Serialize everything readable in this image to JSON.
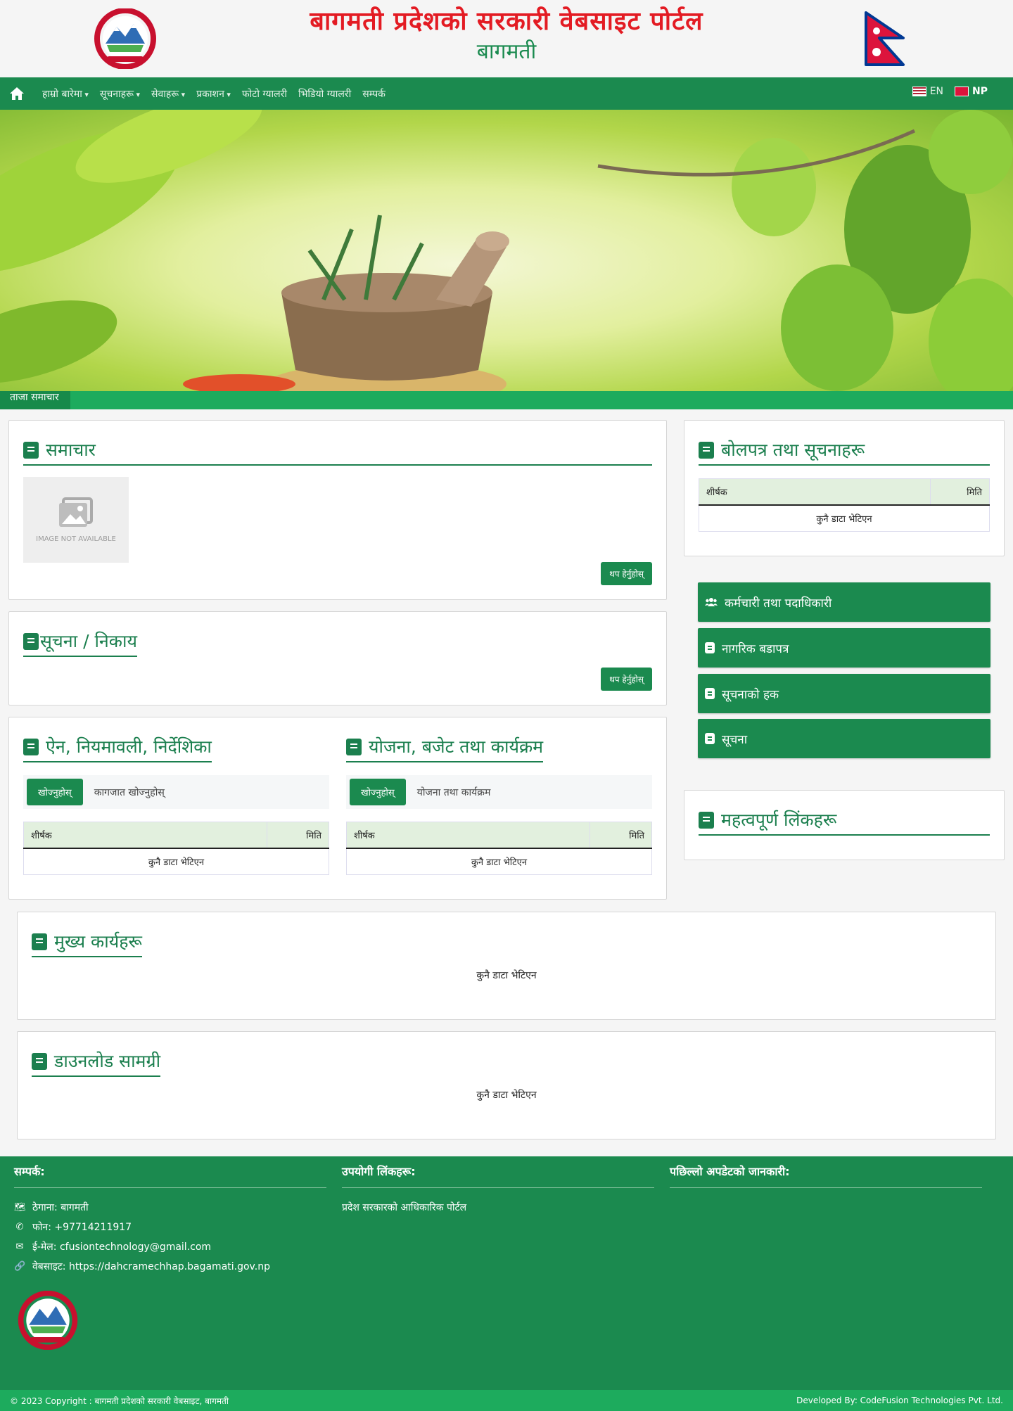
{
  "header": {
    "title": "बागमती प्रदेशको सरकारी वेबसाइट पोर्टल",
    "subtitle": "बागमती"
  },
  "nav": {
    "items": [
      {
        "label": "हाम्रो बारेमा",
        "dropdown": true
      },
      {
        "label": "सूचनाहरू",
        "dropdown": true
      },
      {
        "label": "सेवाहरू",
        "dropdown": true
      },
      {
        "label": "प्रकाशन",
        "dropdown": true
      },
      {
        "label": "फोटो ग्यालरी",
        "dropdown": false
      },
      {
        "label": "भिडियो ग्यालरी",
        "dropdown": false
      },
      {
        "label": "सम्पर्क",
        "dropdown": false
      }
    ],
    "lang_en": "EN",
    "lang_np": "NP"
  },
  "ticker": {
    "label": "ताजा समाचार"
  },
  "news": {
    "title": "समाचार",
    "image_text": "IMAGE NOT AVAILABLE",
    "more": "थप हेर्नुहोस्"
  },
  "notice": {
    "title": "सूचना / निकाय",
    "more": "थप हेर्नुहोस्"
  },
  "left_table": {
    "title": "ऐन, नियमावली, निर्देशिका",
    "button": "खोज्नुहोस्",
    "search_placeholder": "कागजात खोज्नुहोस्",
    "col1": "शीर्षक",
    "col2": "मिति",
    "empty": "कुनै डाटा भेटिएन"
  },
  "right_table": {
    "title": "योजना, बजेट तथा कार्यक्रम",
    "button": "खोज्नुहोस्",
    "search_placeholder": "योजना तथा कार्यक्रम",
    "col1": "शीर्षक",
    "col2": "मिति",
    "empty": "कुनै डाटा भेटिएन"
  },
  "side_table": {
    "title": "बोलपत्र तथा सूचनाहरू",
    "col1": "शीर्षक",
    "col2": "मिति",
    "empty": "कुनै डाटा भेटिएन"
  },
  "side_buttons": [
    {
      "label": "कर्मचारी तथा पदाधिकारी",
      "icon": "users-icon"
    },
    {
      "label": "नागरिक बडापत्र",
      "icon": "book-icon"
    },
    {
      "label": "सूचनाको हक",
      "icon": "book-icon"
    },
    {
      "label": "सूचना",
      "icon": "book-icon"
    }
  ],
  "side_section": {
    "title": "महत्वपूर्ण लिंकहरू"
  },
  "section_a": {
    "title": "मुख्य कार्यहरू",
    "empty": "कुनै डाटा भेटिएन"
  },
  "section_b": {
    "title": "डाउनलोड सामग्री",
    "empty": "कुनै डाटा भेटिएन"
  },
  "footer": {
    "col1_title": "सम्पर्क:",
    "address": "ठेगाना: बागमती",
    "phone": "फोन: +97714211917",
    "email": "ई-मेल: cfusiontechnology@gmail.com",
    "website": "वेबसाइट: https://dahcramechhap.bagamati.gov.np",
    "col2_title": "उपयोगी लिंकहरू:",
    "col2_item": "प्रदेश सरकारको आधिकारिक पोर्टल",
    "col3_title": "पछिल्लो अपडेटको जानकारी:"
  },
  "copyright": {
    "left": "© 2023 Copyright : बागमती प्रदेशको सरकारी वेबसाइट, बागमती",
    "right": "Developed By: CodeFusion Technologies Pvt. Ltd."
  },
  "colors": {
    "primary": "#1b8a4f",
    "title_red": "#e31b23",
    "ticker": "#1dab5d"
  }
}
